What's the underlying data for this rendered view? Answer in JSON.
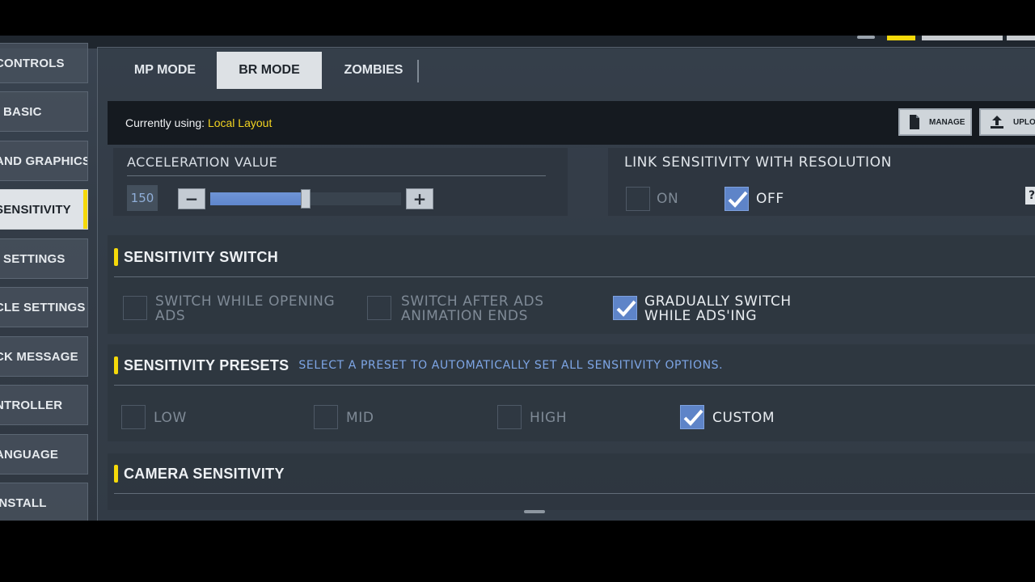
{
  "nav": {
    "items": [
      {
        "label": "CONTROLS",
        "active": false
      },
      {
        "label": "BASIC",
        "active": false
      },
      {
        "label": "AND GRAPHICS",
        "active": false
      },
      {
        "label": "SENSITIVITY",
        "active": true
      },
      {
        "label": "SETTINGS",
        "active": false
      },
      {
        "label": "CLE SETTINGS",
        "active": false
      },
      {
        "label": "CK MESSAGE",
        "active": false
      },
      {
        "label": "NTROLLER",
        "active": false
      },
      {
        "label": "ANGUAGE",
        "active": false
      },
      {
        "label": "INSTALL",
        "active": false
      }
    ]
  },
  "tabs": {
    "items": [
      {
        "label": "MP MODE",
        "active": false
      },
      {
        "label": "BR MODE",
        "active": true
      },
      {
        "label": "ZOMBIES",
        "active": false
      }
    ]
  },
  "layout": {
    "prefix": "Currently using:",
    "name": "Local Layout",
    "manage_label": "MANAGE",
    "upload_label": "UPLOA"
  },
  "acceleration": {
    "title": "ACCELERATION VALUE",
    "value": "150",
    "minus_label": "−",
    "plus_label": "+",
    "slider_fraction": 0.5
  },
  "link_resolution": {
    "title": "LINK SENSITIVITY WITH RESOLUTION",
    "help_label": "?",
    "on_label": "ON",
    "off_label": "OFF",
    "selected": "OFF"
  },
  "sensitivity_switch": {
    "title": "SENSITIVITY SWITCH",
    "options": [
      {
        "label_line1": "SWITCH WHILE OPENING",
        "label_line2": "ADS",
        "checked": false
      },
      {
        "label_line1": "SWITCH AFTER ADS",
        "label_line2": "ANIMATION ENDS",
        "checked": false
      },
      {
        "label_line1": "GRADUALLY SWITCH",
        "label_line2": "WHILE ADS'ING",
        "checked": true
      }
    ]
  },
  "presets": {
    "title": "SENSITIVITY PRESETS",
    "hint": "SELECT A PRESET TO AUTOMATICALLY SET ALL SENSITIVITY OPTIONS.",
    "options": [
      {
        "label": "LOW",
        "checked": false
      },
      {
        "label": "MID",
        "checked": false
      },
      {
        "label": "HIGH",
        "checked": false
      },
      {
        "label": "CUSTOM",
        "checked": true
      }
    ]
  },
  "camera": {
    "title": "CAMERA SENSITIVITY"
  },
  "colors": {
    "accent_yellow": "#f5d90a",
    "checkbox_blue": "#5e84c8",
    "slider_fill": "#6f94d6",
    "hint_blue": "#7ea6e6",
    "layout_name": "#f2d321"
  }
}
